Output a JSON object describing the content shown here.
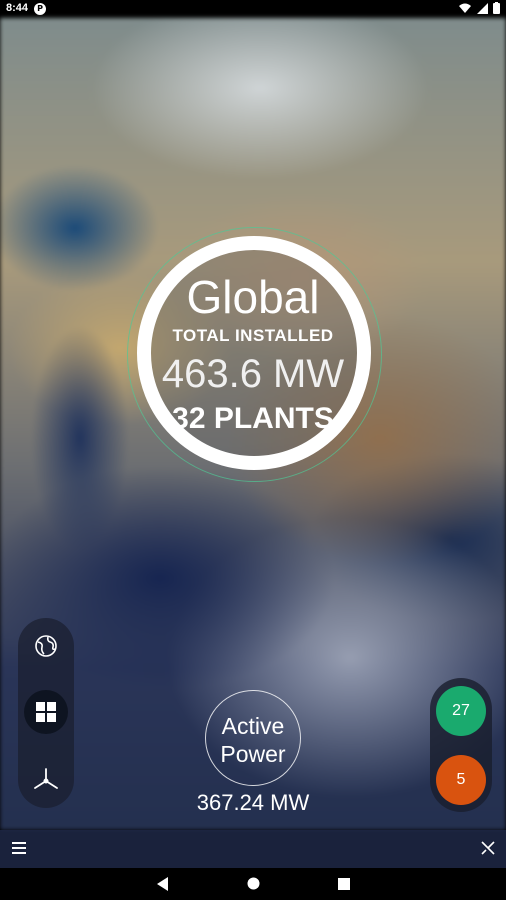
{
  "status_bar": {
    "time": "8:44",
    "app_badge": "P",
    "system_icons": [
      "wifi-icon",
      "signal-icon",
      "battery-icon"
    ]
  },
  "hero": {
    "title": "Global",
    "total_label": "TOTAL INSTALLED",
    "total_value": "463.6 MW",
    "plants": "32 PLANTS"
  },
  "left_nav": {
    "items": [
      {
        "icon": "globe-icon",
        "active": false
      },
      {
        "icon": "grid-icon",
        "active": true
      },
      {
        "icon": "wind-turbine-icon",
        "active": false
      }
    ]
  },
  "active_power": {
    "label_line1": "Active",
    "label_line2": "Power",
    "value": "367.24 MW"
  },
  "status_badges": [
    {
      "count": "27",
      "color": "#1aaa6e"
    },
    {
      "count": "5",
      "color": "#d9530f"
    }
  ],
  "bottom_bar": {
    "left_icon": "menu-icon",
    "right_icon": "x-logo-icon"
  },
  "nav_bar": {
    "buttons": [
      "back",
      "home",
      "recents"
    ]
  }
}
